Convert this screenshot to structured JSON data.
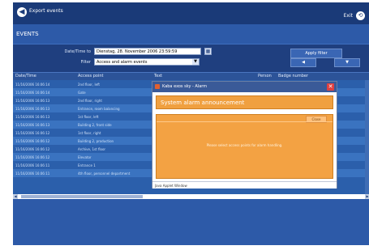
{
  "header": {
    "back_glyph": "◀",
    "title": "Export events",
    "exit_label": "Exit",
    "exit_glyph": "⟲"
  },
  "section": {
    "title": "EVENTS"
  },
  "filters": {
    "date_label": "Date/Time to",
    "date_value": "Dienstag, 28. November 2006 23:59:59",
    "calendar_glyph": "▦",
    "filter_label": "Filter",
    "filter_value": "Access and alarm events",
    "dropdown_glyph": "▼",
    "apply_label": "Apply filter",
    "prev_glyph": "◀",
    "next_glyph": "▼"
  },
  "table": {
    "columns": [
      "Date/Time",
      "Access point",
      "Text",
      "Person",
      "Badge number"
    ],
    "rows": [
      {
        "datetime": "11/16/2006 16:06:14",
        "access_point": "2nd floor, left"
      },
      {
        "datetime": "11/16/2006 16:06:14",
        "access_point": "Gate"
      },
      {
        "datetime": "11/16/2006 16:06:13",
        "access_point": "2nd floor, right"
      },
      {
        "datetime": "11/16/2006 16:06:13",
        "access_point": "Entrance, room balancing"
      },
      {
        "datetime": "11/16/2006 16:06:13",
        "access_point": "1st floor, left"
      },
      {
        "datetime": "11/16/2006 16:06:13",
        "access_point": "Building 2, front side"
      },
      {
        "datetime": "11/16/2006 16:06:12",
        "access_point": "1st floor, right"
      },
      {
        "datetime": "11/16/2006 16:06:12",
        "access_point": "Building 2, production"
      },
      {
        "datetime": "11/16/2006 16:06:12",
        "access_point": "Archive, 1st floor"
      },
      {
        "datetime": "11/16/2006 16:06:12",
        "access_point": "Elevator"
      },
      {
        "datetime": "11/16/2006 16:06:11",
        "access_point": "Entrance 1"
      },
      {
        "datetime": "11/16/2006 16:06:11",
        "access_point": "4th floor, personnel department"
      }
    ]
  },
  "scroll": {
    "left_glyph": "◀",
    "right_glyph": "▶"
  },
  "dialog": {
    "title": "Kaba exos sky - Alarm",
    "close_glyph": "✕",
    "heading": "System alarm announcement",
    "close_label": "Close",
    "message": "Please select access points for alarm handling.",
    "status": "Java Applet Window"
  },
  "colors": {
    "background": "#1f3f7f",
    "section": "#2d5aa8",
    "alarm": "#f3a243",
    "dialog_title": "#3a5a98"
  }
}
